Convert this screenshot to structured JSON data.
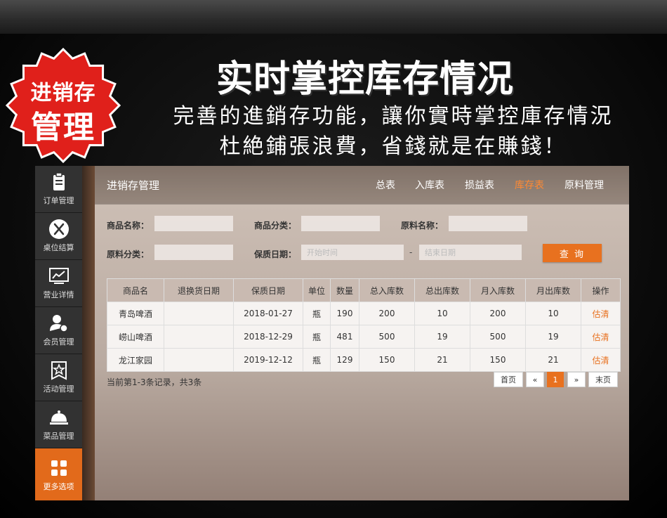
{
  "badge": {
    "line1": "进销存",
    "line2": "管理",
    "color": "#e0201b"
  },
  "headline": "实时掌控库存情况",
  "subline1": "完善的進銷存功能，讓你實時掌控庫存情況",
  "subline2": "杜絶鋪張浪費，省錢就是在賺錢！",
  "sidebar": {
    "items": [
      {
        "label": "订单管理",
        "icon": "clipboard-icon"
      },
      {
        "label": "桌位结算",
        "icon": "utensils-icon"
      },
      {
        "label": "营业详情",
        "icon": "chart-monitor-icon"
      },
      {
        "label": "会员管理",
        "icon": "member-icon"
      },
      {
        "label": "活动管理",
        "icon": "star-badge-icon"
      },
      {
        "label": "菜品管理",
        "icon": "cloche-icon"
      },
      {
        "label": "更多选项",
        "icon": "grid-icon",
        "active": true
      }
    ]
  },
  "app_title": "进销存管理",
  "nav": [
    "总表",
    "入库表",
    "损益表",
    "库存表",
    "原料管理"
  ],
  "nav_active": "库存表",
  "filters": {
    "product_name_label": "商品名称：",
    "product_category_label": "商品分类：",
    "material_name_label": "原料名称：",
    "material_category_label": "原料分类：",
    "shelf_life_label": "保质日期：",
    "start_placeholder": "开始时间",
    "end_placeholder": "结束日期",
    "range_separator": "-",
    "query_label": "查 询"
  },
  "table": {
    "columns": [
      "商品名",
      "退换货日期",
      "保质日期",
      "单位",
      "数量",
      "总入库数",
      "总出库数",
      "月入库数",
      "月出库数",
      "操作"
    ],
    "rows": [
      [
        "青岛啤酒",
        "",
        "2018-01-27",
        "瓶",
        "190",
        "200",
        "10",
        "200",
        "10",
        "估清"
      ],
      [
        "崂山啤酒",
        "",
        "2018-12-29",
        "瓶",
        "481",
        "500",
        "19",
        "500",
        "19",
        "估清"
      ],
      [
        "龙江家园",
        "",
        "2019-12-12",
        "瓶",
        "129",
        "150",
        "21",
        "150",
        "21",
        "估清"
      ]
    ]
  },
  "summary": "当前第1-3条记录，共3条",
  "pagination": {
    "first": "首页",
    "prev": "«",
    "current": "1",
    "next": "»",
    "last": "末页"
  },
  "colors": {
    "accent": "#e8711f",
    "badge_red": "#e0201b"
  }
}
